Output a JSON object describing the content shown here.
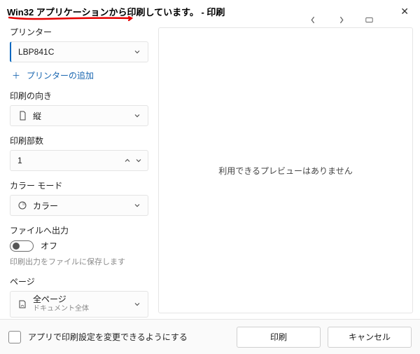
{
  "title": "Win32 アプリケーションから印刷しています。 - 印刷",
  "preview_message": "利用できるプレビューはありません",
  "printer": {
    "label": "プリンター",
    "value": "LBP841C",
    "add_label": "プリンターの追加"
  },
  "orientation": {
    "label": "印刷の向き",
    "value": "縦"
  },
  "copies": {
    "label": "印刷部数",
    "value": "1"
  },
  "color_mode": {
    "label": "カラー モード",
    "value": "カラー"
  },
  "file_output": {
    "label": "ファイルへ出力",
    "state": "オフ",
    "helper": "印刷出力をファイルに保存します"
  },
  "pages": {
    "label": "ページ",
    "value": "全ページ",
    "sub": "ドキュメント全体"
  },
  "bottom": {
    "checkbox_label": "アプリで印刷設定を変更できるようにする",
    "print": "印刷",
    "cancel": "キャンセル"
  }
}
